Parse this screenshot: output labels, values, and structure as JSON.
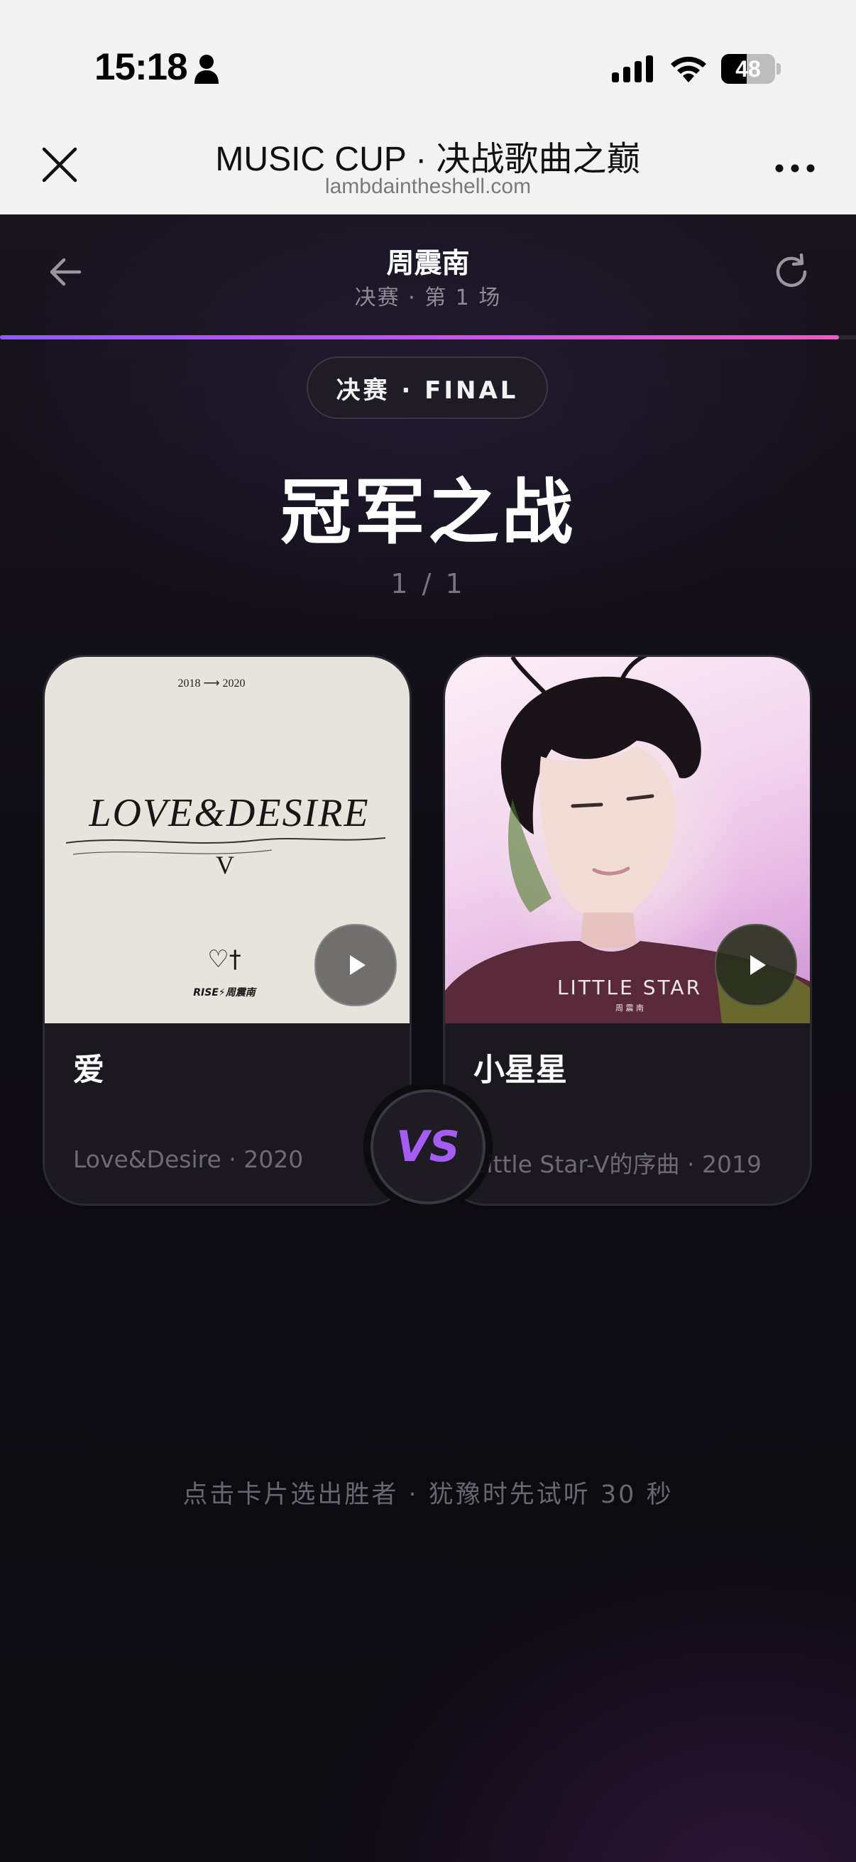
{
  "status_bar": {
    "time": "15:18",
    "battery": "48",
    "battery_level": 0.48
  },
  "browser": {
    "title": "MUSIC CUP · 决战歌曲之巅",
    "url": "lambdaintheshell.com"
  },
  "header": {
    "artist": "周震南",
    "round_info": "决赛 · 第 1 场",
    "progress": 0.98
  },
  "stage": {
    "badge": "决赛 · FINAL",
    "title": "冠军之战",
    "counter": "1 / 1"
  },
  "cards": [
    {
      "title": "爱",
      "meta": "Love&Desire · 2020",
      "cover": {
        "years": "2018 ⟶ 2020",
        "album": "LOVE&DESIRE",
        "volume": "V",
        "symbol": "♡†",
        "label": "RISE⚡周震南"
      }
    },
    {
      "title": "小星星",
      "meta": "Little Star-V的序曲 · 2019",
      "cover": {
        "album": "LITTLE STAR",
        "artist": "周 震 南"
      }
    }
  ],
  "vs_label": "VS",
  "hint": "点击卡片选出胜者 · 犹豫时先试听 30 秒",
  "colors": {
    "accent_purple": "#a45cf3",
    "progress_start": "#8f5cf6",
    "progress_end": "#e85dc0",
    "background": "#0d0b12"
  }
}
